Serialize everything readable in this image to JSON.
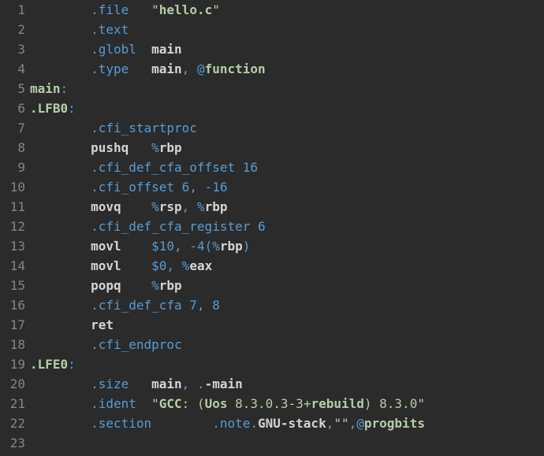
{
  "lines": [
    {
      "n": 1,
      "tokens": [
        [
          "default",
          "        "
        ],
        [
          "directive",
          ".file"
        ],
        [
          "default",
          "   "
        ],
        [
          "string",
          "\""
        ],
        [
          "strbold",
          "hello.c"
        ],
        [
          "string",
          "\""
        ]
      ]
    },
    {
      "n": 2,
      "tokens": [
        [
          "default",
          "        "
        ],
        [
          "directive",
          ".text"
        ]
      ]
    },
    {
      "n": 3,
      "tokens": [
        [
          "default",
          "        "
        ],
        [
          "directive",
          ".globl"
        ],
        [
          "default",
          "  "
        ],
        [
          "default",
          "main"
        ]
      ]
    },
    {
      "n": 4,
      "tokens": [
        [
          "default",
          "        "
        ],
        [
          "directive",
          ".type"
        ],
        [
          "default",
          "   "
        ],
        [
          "default",
          "main"
        ],
        [
          "op",
          ","
        ],
        [
          "default",
          " "
        ],
        [
          "at",
          "@"
        ],
        [
          "func",
          "function"
        ]
      ]
    },
    {
      "n": 5,
      "tokens": [
        [
          "label",
          "main"
        ],
        [
          "colon",
          ":"
        ]
      ]
    },
    {
      "n": 6,
      "tokens": [
        [
          "label",
          ".LFB0"
        ],
        [
          "colon",
          ":"
        ]
      ]
    },
    {
      "n": 7,
      "tokens": [
        [
          "default",
          "        "
        ],
        [
          "directive",
          ".cfi_startproc"
        ]
      ]
    },
    {
      "n": 8,
      "tokens": [
        [
          "default",
          "        "
        ],
        [
          "default",
          "pushq   "
        ],
        [
          "regpct",
          "%"
        ],
        [
          "reg",
          "rbp"
        ]
      ]
    },
    {
      "n": 9,
      "tokens": [
        [
          "default",
          "        "
        ],
        [
          "directive",
          ".cfi_def_cfa_offset"
        ],
        [
          "default",
          " "
        ],
        [
          "number",
          "16"
        ]
      ]
    },
    {
      "n": 10,
      "tokens": [
        [
          "default",
          "        "
        ],
        [
          "directive",
          ".cfi_offset"
        ],
        [
          "default",
          " "
        ],
        [
          "number",
          "6"
        ],
        [
          "op",
          ","
        ],
        [
          "default",
          " "
        ],
        [
          "number",
          "-16"
        ]
      ]
    },
    {
      "n": 11,
      "tokens": [
        [
          "default",
          "        "
        ],
        [
          "default",
          "movq    "
        ],
        [
          "regpct",
          "%"
        ],
        [
          "reg",
          "rsp"
        ],
        [
          "op",
          ","
        ],
        [
          "default",
          " "
        ],
        [
          "regpct",
          "%"
        ],
        [
          "reg",
          "rbp"
        ]
      ]
    },
    {
      "n": 12,
      "tokens": [
        [
          "default",
          "        "
        ],
        [
          "directive",
          ".cfi_def_cfa_register"
        ],
        [
          "default",
          " "
        ],
        [
          "number",
          "6"
        ]
      ]
    },
    {
      "n": 13,
      "tokens": [
        [
          "default",
          "        "
        ],
        [
          "default",
          "movl    "
        ],
        [
          "number",
          "$10"
        ],
        [
          "op",
          ","
        ],
        [
          "default",
          " "
        ],
        [
          "number",
          "-4"
        ],
        [
          "op",
          "("
        ],
        [
          "regpct",
          "%"
        ],
        [
          "reg",
          "rbp"
        ],
        [
          "op",
          ")"
        ]
      ]
    },
    {
      "n": 14,
      "tokens": [
        [
          "default",
          "        "
        ],
        [
          "default",
          "movl    "
        ],
        [
          "number",
          "$0"
        ],
        [
          "op",
          ","
        ],
        [
          "default",
          " "
        ],
        [
          "regpct",
          "%"
        ],
        [
          "reg",
          "eax"
        ]
      ]
    },
    {
      "n": 15,
      "tokens": [
        [
          "default",
          "        "
        ],
        [
          "default",
          "popq    "
        ],
        [
          "regpct",
          "%"
        ],
        [
          "reg",
          "rbp"
        ]
      ]
    },
    {
      "n": 16,
      "tokens": [
        [
          "default",
          "        "
        ],
        [
          "directive",
          ".cfi_def_cfa"
        ],
        [
          "default",
          " "
        ],
        [
          "number",
          "7"
        ],
        [
          "op",
          ","
        ],
        [
          "default",
          " "
        ],
        [
          "number",
          "8"
        ]
      ]
    },
    {
      "n": 17,
      "tokens": [
        [
          "default",
          "        "
        ],
        [
          "default",
          "ret"
        ]
      ]
    },
    {
      "n": 18,
      "tokens": [
        [
          "default",
          "        "
        ],
        [
          "directive",
          ".cfi_endproc"
        ]
      ]
    },
    {
      "n": 19,
      "tokens": [
        [
          "label",
          ".LFE0"
        ],
        [
          "colon",
          ":"
        ]
      ]
    },
    {
      "n": 20,
      "tokens": [
        [
          "default",
          "        "
        ],
        [
          "directive",
          ".size"
        ],
        [
          "default",
          "   "
        ],
        [
          "default",
          "main"
        ],
        [
          "op",
          ","
        ],
        [
          "default",
          " "
        ],
        [
          "op",
          "."
        ],
        [
          "default",
          "-main"
        ]
      ]
    },
    {
      "n": 21,
      "tokens": [
        [
          "default",
          "        "
        ],
        [
          "directive",
          ".ident"
        ],
        [
          "default",
          "  "
        ],
        [
          "string",
          "\""
        ],
        [
          "strbold",
          "GCC"
        ],
        [
          "string",
          ": ("
        ],
        [
          "strbold",
          "Uos"
        ],
        [
          "string",
          " 8.3.0.3-3+"
        ],
        [
          "strbold",
          "rebuild"
        ],
        [
          "string",
          ") 8.3.0\""
        ]
      ]
    },
    {
      "n": 22,
      "tokens": [
        [
          "default",
          "        "
        ],
        [
          "directive",
          ".section"
        ],
        [
          "default",
          "        "
        ],
        [
          "directive",
          ".note"
        ],
        [
          "op",
          "."
        ],
        [
          "default",
          "GNU-stack"
        ],
        [
          "op",
          ","
        ],
        [
          "string",
          "\"\""
        ],
        [
          "op",
          ","
        ],
        [
          "at",
          "@"
        ],
        [
          "func",
          "progbits"
        ]
      ]
    },
    {
      "n": 23,
      "tokens": []
    }
  ]
}
